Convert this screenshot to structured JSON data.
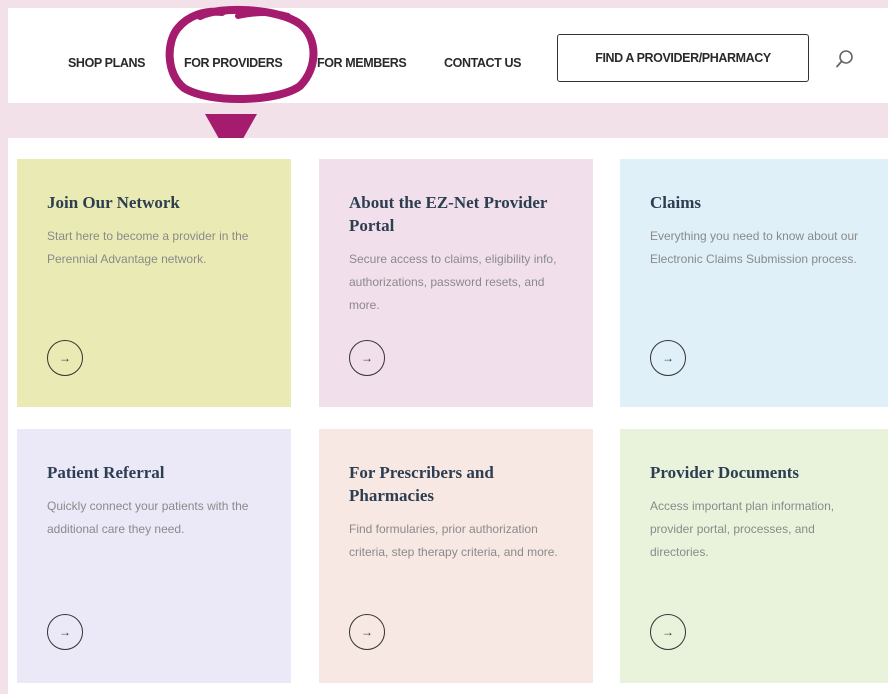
{
  "nav": {
    "shop_plans": "SHOP PLANS",
    "for_providers": "FOR PROVIDERS",
    "for_members": "FOR MEMBERS",
    "contact_us": "CONTACT US",
    "find_provider": "FIND A PROVIDER/PHARMACY",
    "search_icon": "search-icon"
  },
  "annotation": {
    "highlight_color": "#a51c6e"
  },
  "cards": [
    {
      "title": "Join Our Network",
      "description": "Start here to become a provider in the Perennial Advantage network.",
      "arrow": "→",
      "bg": "#eaebb4"
    },
    {
      "title": "About the EZ-Net Provider Portal",
      "description": "Secure access to claims, eligibility info, authorizations, password resets, and more.",
      "arrow": "→",
      "bg": "#f1dfec"
    },
    {
      "title": "Claims",
      "description": "Everything you need to know about our Electronic Claims Submission process.",
      "arrow": "→",
      "bg": "#dff0f8"
    },
    {
      "title": "Patient Referral",
      "description": "Quickly connect your patients with the additional care they need.",
      "arrow": "→",
      "bg": "#ebe9f8"
    },
    {
      "title": "For Prescribers and Pharmacies",
      "description": "Find formularies, prior authorization criteria, step therapy criteria, and more.",
      "arrow": "→",
      "bg": "#f8e8e3"
    },
    {
      "title": "Provider Documents",
      "description": "Access important plan information, provider portal, processes, and directories.",
      "arrow": "→",
      "bg": "#e9f3dc"
    }
  ]
}
